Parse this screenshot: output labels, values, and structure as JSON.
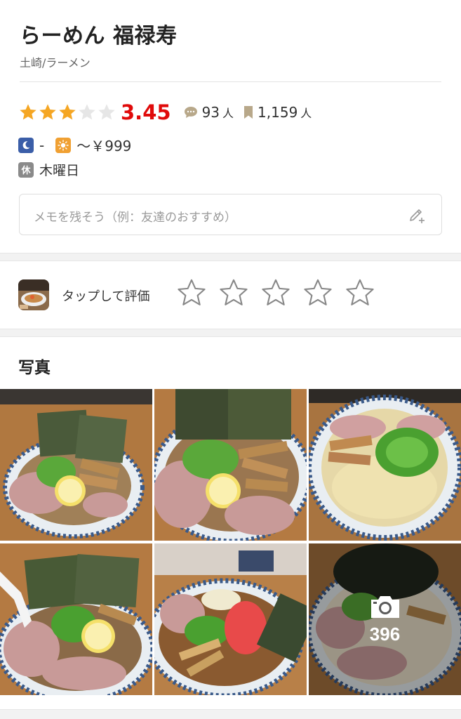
{
  "shop": {
    "name": "らーめん 福禄寿",
    "area_genre": "土崎/ラーメン"
  },
  "rating": {
    "score": "3.45",
    "stars_filled": 3,
    "stars_total": 5,
    "reviews_count": "93",
    "reviews_unit": "人",
    "saves_count": "1,159",
    "saves_unit": "人",
    "star_color": "#f5a623",
    "score_color": "#e00a0a"
  },
  "budget": {
    "dinner": "-",
    "lunch": "～￥999",
    "dinner_icon": "moon-icon",
    "lunch_icon": "sun-icon"
  },
  "holiday": {
    "badge": "休",
    "value": "木曜日"
  },
  "memo": {
    "placeholder": "メモを残そう（例：友達のおすすめ）",
    "icon": "pencil-plus-icon"
  },
  "rate": {
    "label": "タップして評価",
    "star_count": 5
  },
  "photos": {
    "title": "写真",
    "more_count": "396",
    "more_icon": "camera-icon"
  }
}
